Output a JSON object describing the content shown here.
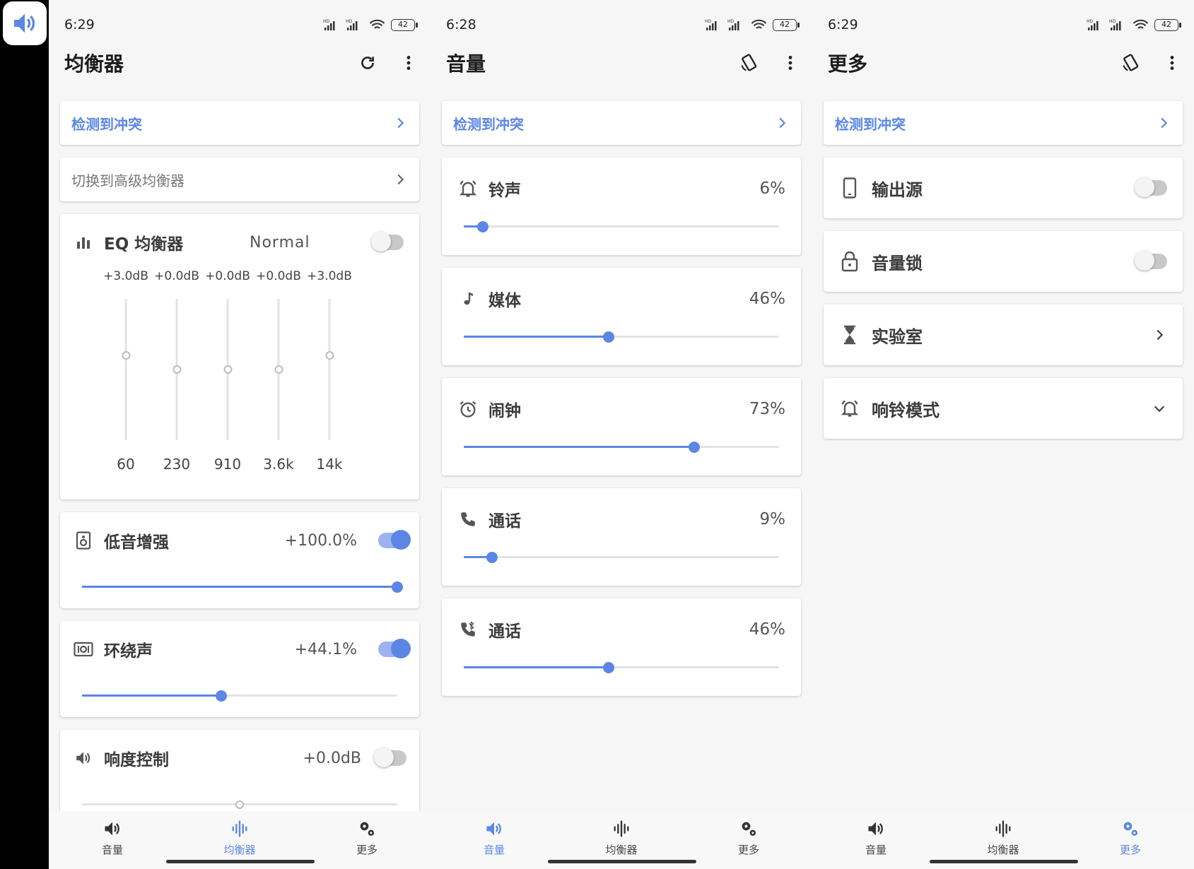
{
  "accent": "#5b86e5",
  "status_battery": "42",
  "nav": {
    "volume": "音量",
    "equalizer": "均衡器",
    "more": "更多"
  },
  "screens": {
    "equalizer": {
      "time": "6:29",
      "title": "均衡器",
      "conflict_banner": "检测到冲突",
      "switch_banner": "切换到高级均衡器",
      "eq": {
        "title": "EQ 均衡器",
        "preset": "Normal",
        "enabled": false,
        "bands": [
          {
            "gain": "+3.0dB",
            "freq": "60",
            "level": 0.6
          },
          {
            "gain": "+0.0dB",
            "freq": "230",
            "level": 0.5
          },
          {
            "gain": "+0.0dB",
            "freq": "910",
            "level": 0.5
          },
          {
            "gain": "+0.0dB",
            "freq": "3.6k",
            "level": 0.5
          },
          {
            "gain": "+3.0dB",
            "freq": "14k",
            "level": 0.6
          }
        ]
      },
      "bass": {
        "title": "低音增强",
        "value": "+100.0%",
        "enabled": true,
        "level": 1.0
      },
      "surround": {
        "title": "环绕声",
        "value": "+44.1%",
        "enabled": true,
        "level": 0.441
      },
      "loudness": {
        "title": "响度控制",
        "value": "+0.0dB",
        "enabled": false,
        "level": 0.5
      }
    },
    "volume": {
      "time": "6:28",
      "title": "音量",
      "conflict_banner": "检测到冲突",
      "streams": [
        {
          "name": "铃声",
          "icon": "bell-icon",
          "value": "6%",
          "level": 0.06
        },
        {
          "name": "媒体",
          "icon": "music-note-icon",
          "value": "46%",
          "level": 0.46
        },
        {
          "name": "闹钟",
          "icon": "alarm-clock-icon",
          "value": "73%",
          "level": 0.73
        },
        {
          "name": "通话",
          "icon": "phone-icon",
          "value": "9%",
          "level": 0.09
        },
        {
          "name": "通话",
          "icon": "bluetooth-call-icon",
          "value": "46%",
          "level": 0.46
        }
      ]
    },
    "more": {
      "time": "6:29",
      "title": "更多",
      "conflict_banner": "检测到冲突",
      "items": [
        {
          "label": "输出源",
          "icon": "phone-device-icon",
          "trail": "toggle-off"
        },
        {
          "label": "音量锁",
          "icon": "lock-icon",
          "trail": "toggle-off"
        },
        {
          "label": "实验室",
          "icon": "hourglass-icon",
          "trail": "chevron-right"
        },
        {
          "label": "响铃模式",
          "icon": "bell-icon",
          "trail": "chevron-down"
        }
      ]
    }
  }
}
